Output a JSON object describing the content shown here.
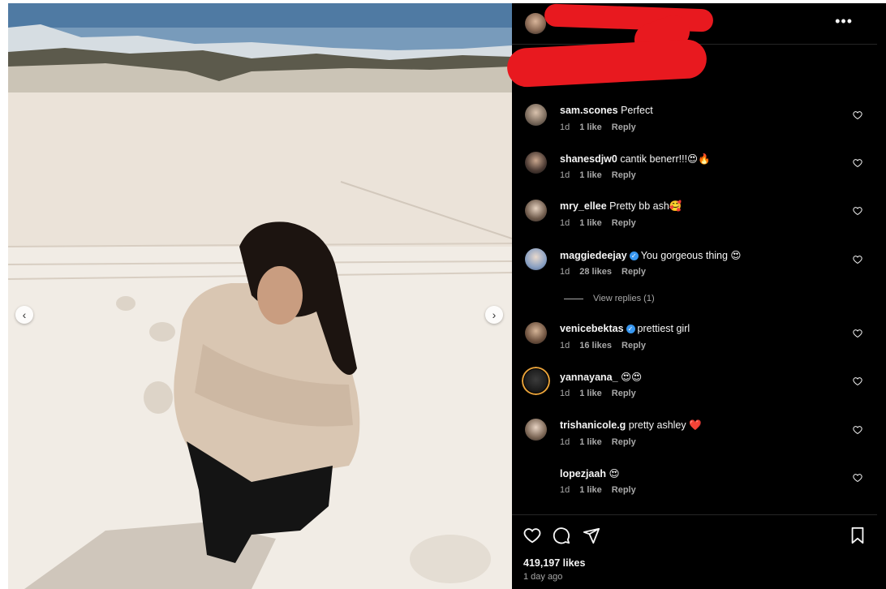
{
  "post": {
    "image_alt": "Woman in a beige puffer jacket crouching in snow",
    "more_label": "•••"
  },
  "comments": [
    {
      "user": "sam.scones",
      "verified": false,
      "text": "Perfect",
      "time": "1d",
      "likes": "1 like",
      "reply": "Reply"
    },
    {
      "user": "shanesdjw0",
      "verified": false,
      "text": "cantik benerr!!!😍🔥",
      "time": "1d",
      "likes": "1 like",
      "reply": "Reply"
    },
    {
      "user": "mry_ellee",
      "verified": false,
      "text": "Pretty bb ash🥰",
      "time": "1d",
      "likes": "1 like",
      "reply": "Reply"
    },
    {
      "user": "maggiedeejay",
      "verified": true,
      "text": "You gorgeous thing 😍",
      "time": "1d",
      "likes": "28 likes",
      "reply": "Reply"
    },
    {
      "user": "venicebektas",
      "verified": true,
      "text": "prettiest girl",
      "time": "1d",
      "likes": "16 likes",
      "reply": "Reply"
    },
    {
      "user": "yannayana_",
      "verified": false,
      "text": "😍😍",
      "time": "1d",
      "likes": "1 like",
      "reply": "Reply"
    },
    {
      "user": "trishanicole.g",
      "verified": false,
      "text": "pretty ashley ❤️",
      "time": "1d",
      "likes": "1 like",
      "reply": "Reply"
    },
    {
      "user": "lopezjaah",
      "verified": false,
      "text": "😍",
      "time": "1d",
      "likes": "1 like",
      "reply": "Reply"
    }
  ],
  "view_replies": "View replies (1)",
  "footer": {
    "likes": "419,197 likes",
    "time": "1 day ago"
  },
  "colors": {
    "panel_bg": "#000000",
    "redaction": "#e8191f",
    "verified": "#3897f0"
  }
}
